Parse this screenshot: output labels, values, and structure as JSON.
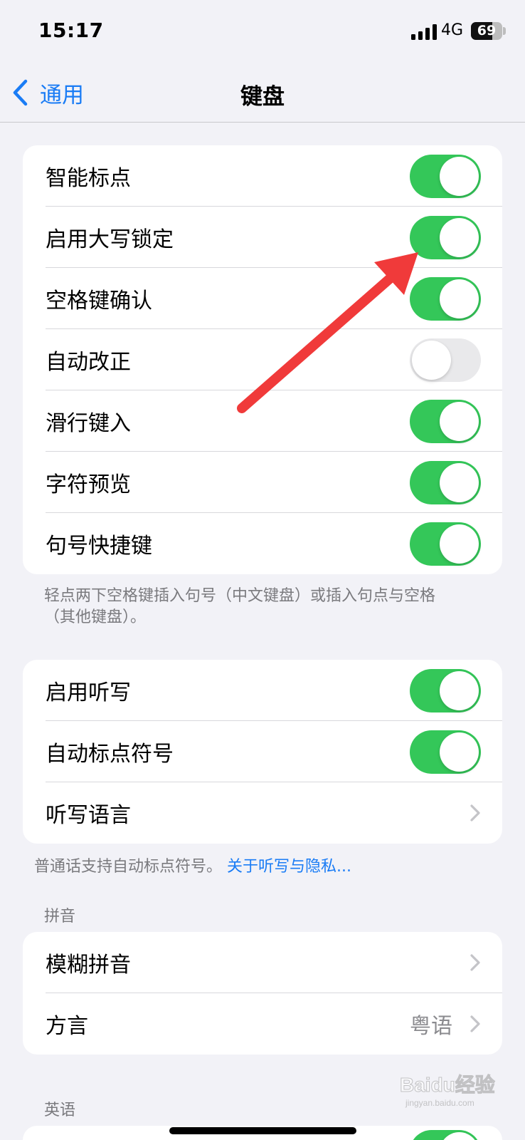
{
  "status_bar": {
    "time": "15:17",
    "network": "4G",
    "battery_level": "69"
  },
  "nav": {
    "back_label": "通用",
    "title": "键盘"
  },
  "group1": {
    "rows": [
      {
        "label": "智能标点",
        "toggle": "on"
      },
      {
        "label": "启用大写锁定",
        "toggle": "on"
      },
      {
        "label": "空格键确认",
        "toggle": "on"
      },
      {
        "label": "自动改正",
        "toggle": "off"
      },
      {
        "label": "滑行键入",
        "toggle": "on"
      },
      {
        "label": "字符预览",
        "toggle": "on"
      },
      {
        "label": "句号快捷键",
        "toggle": "on"
      }
    ],
    "footnote_line1": "轻点两下空格键插入句号（中文键盘）或插入句点与空格",
    "footnote_line2": "（其他键盘）。"
  },
  "group2": {
    "rows": [
      {
        "label": "启用听写",
        "toggle": "on"
      },
      {
        "label": "自动标点符号",
        "toggle": "on"
      },
      {
        "label": "听写语言"
      }
    ],
    "footnote_text": "普通话支持自动标点符号。",
    "footnote_link": "关于听写与隐私..."
  },
  "pinyin_section": {
    "header": "拼音",
    "rows": [
      {
        "label": "模糊拼音"
      },
      {
        "label": "方言",
        "value": "粤语"
      }
    ]
  },
  "english_section": {
    "header": "英语"
  },
  "watermark": {
    "text": "Baidu经验",
    "sub": "jingyan.baidu.com"
  },
  "colors": {
    "toggle_on": "#34c759",
    "toggle_off": "#e9e9eb",
    "accent": "#1a7cf5",
    "annotation_arrow": "#f03a3a"
  }
}
